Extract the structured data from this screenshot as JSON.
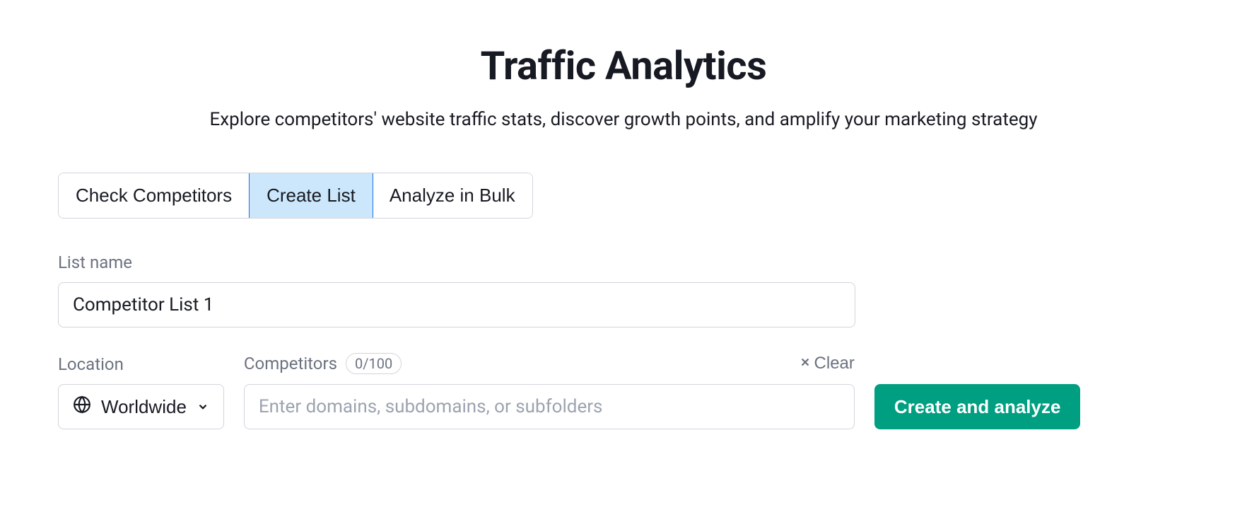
{
  "header": {
    "title": "Traffic Analytics",
    "subtitle": "Explore competitors' website traffic stats, discover growth points, and amplify your marketing strategy"
  },
  "tabs": {
    "items": [
      {
        "label": "Check Competitors",
        "active": false
      },
      {
        "label": "Create List",
        "active": true
      },
      {
        "label": "Analyze in Bulk",
        "active": false
      }
    ]
  },
  "form": {
    "list_name": {
      "label": "List name",
      "value": "Competitor List 1"
    },
    "location": {
      "label": "Location",
      "selected": "Worldwide"
    },
    "competitors": {
      "label": "Competitors",
      "count_badge": "0/100",
      "clear_label": "Clear",
      "placeholder": "Enter domains, subdomains, or subfolders",
      "value": ""
    },
    "submit_label": "Create and analyze"
  },
  "colors": {
    "accent": "#009f81",
    "tab_active_bg": "#cce7fb",
    "tab_active_border": "#1a73e8"
  }
}
